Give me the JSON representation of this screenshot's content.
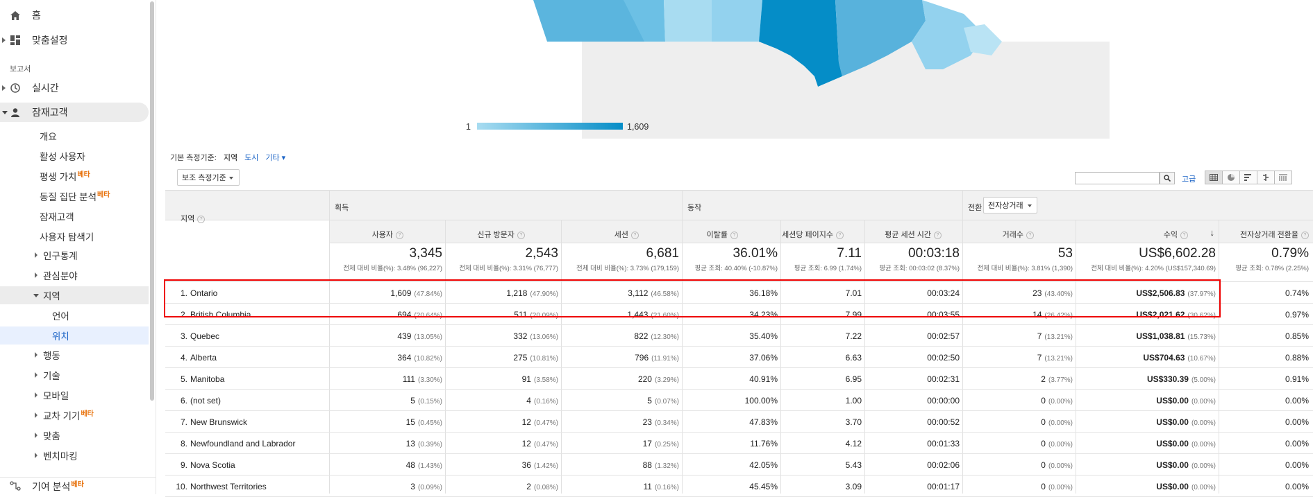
{
  "sidebar": {
    "home": "홈",
    "custom": "맞춤설정",
    "reports_section": "보고서",
    "realtime": "실시간",
    "audience": "잠재고객",
    "items": [
      {
        "label": "개요",
        "beta": ""
      },
      {
        "label": "활성 사용자",
        "beta": ""
      },
      {
        "label": "평생 가치",
        "beta": "베타"
      },
      {
        "label": "동질 집단 분석",
        "beta": "베타"
      },
      {
        "label": "잠재고객",
        "beta": ""
      },
      {
        "label": "사용자 탐색기",
        "beta": ""
      },
      {
        "label": "인구통계",
        "beta": ""
      },
      {
        "label": "관심분야",
        "beta": ""
      },
      {
        "label": "지역",
        "beta": ""
      },
      {
        "label": "언어",
        "beta": ""
      },
      {
        "label": "위치",
        "beta": ""
      },
      {
        "label": "행동",
        "beta": ""
      },
      {
        "label": "기술",
        "beta": ""
      },
      {
        "label": "모바일",
        "beta": ""
      },
      {
        "label": "교차 기기",
        "beta": "베타"
      },
      {
        "label": "맞춤",
        "beta": ""
      },
      {
        "label": "벤치마킹",
        "beta": ""
      }
    ],
    "attribution": "기여 분석",
    "attribution_beta": "베타"
  },
  "map": {
    "legend_min": "1",
    "legend_max": "1,609"
  },
  "toolbar": {
    "primary_dim_label": "기본 측정기준:",
    "dim_region": "지역",
    "dim_city": "도시",
    "dim_other": "기타",
    "secondary_dim": "보조 측정기준",
    "advanced": "고급"
  },
  "table": {
    "dim_header": "지역",
    "groups": {
      "acquisition": "획득",
      "behavior": "동작",
      "conversions": "전환",
      "conversion_select": "전자상거래"
    },
    "columns": [
      "사용자",
      "신규 방문자",
      "세션",
      "이탈률",
      "세션당 페이지수",
      "평균 세션 시간",
      "거래수",
      "수익",
      "전자상거래 전환율"
    ],
    "totals": [
      {
        "big": "3,345",
        "small": "전체 대비 비율(%): 3.48% (96,227)"
      },
      {
        "big": "2,543",
        "small": "전체 대비 비율(%): 3.31% (76,777)"
      },
      {
        "big": "6,681",
        "small": "전체 대비 비율(%): 3.73% (179,159)"
      },
      {
        "big": "36.01%",
        "small": "평균 조회: 40.40% (-10.87%)"
      },
      {
        "big": "7.11",
        "small": "평균 조회: 6.99 (1.74%)"
      },
      {
        "big": "00:03:18",
        "small": "평균 조회: 00:03:02 (8.37%)"
      },
      {
        "big": "53",
        "small": "전체 대비 비율(%): 3.81% (1,390)"
      },
      {
        "big": "US$6,602.28",
        "small": "전체 대비 비율(%): 4.20% (US$157,340.69)"
      },
      {
        "big": "0.79%",
        "small": "평균 조회: 0.78% (2.25%)"
      }
    ],
    "rows": [
      {
        "idx": "1.",
        "name": "Ontario",
        "users": "1,609",
        "users_p": "(47.84%)",
        "new": "1,218",
        "new_p": "(47.90%)",
        "sess": "3,112",
        "sess_p": "(46.58%)",
        "bounce": "36.18%",
        "pps": "7.01",
        "dur": "00:03:24",
        "tx": "23",
        "tx_p": "(43.40%)",
        "rev": "US$2,506.83",
        "rev_p": "(37.97%)",
        "conv": "0.74%"
      },
      {
        "idx": "2.",
        "name": "British Columbia",
        "users": "694",
        "users_p": "(20.64%)",
        "new": "511",
        "new_p": "(20.09%)",
        "sess": "1,443",
        "sess_p": "(21.60%)",
        "bounce": "34.23%",
        "pps": "7.99",
        "dur": "00:03:55",
        "tx": "14",
        "tx_p": "(26.42%)",
        "rev": "US$2,021.62",
        "rev_p": "(30.62%)",
        "conv": "0.97%"
      },
      {
        "idx": "3.",
        "name": "Quebec",
        "users": "439",
        "users_p": "(13.05%)",
        "new": "332",
        "new_p": "(13.06%)",
        "sess": "822",
        "sess_p": "(12.30%)",
        "bounce": "35.40%",
        "pps": "7.22",
        "dur": "00:02:57",
        "tx": "7",
        "tx_p": "(13.21%)",
        "rev": "US$1,038.81",
        "rev_p": "(15.73%)",
        "conv": "0.85%"
      },
      {
        "idx": "4.",
        "name": "Alberta",
        "users": "364",
        "users_p": "(10.82%)",
        "new": "275",
        "new_p": "(10.81%)",
        "sess": "796",
        "sess_p": "(11.91%)",
        "bounce": "37.06%",
        "pps": "6.63",
        "dur": "00:02:50",
        "tx": "7",
        "tx_p": "(13.21%)",
        "rev": "US$704.63",
        "rev_p": "(10.67%)",
        "conv": "0.88%"
      },
      {
        "idx": "5.",
        "name": "Manitoba",
        "users": "111",
        "users_p": "(3.30%)",
        "new": "91",
        "new_p": "(3.58%)",
        "sess": "220",
        "sess_p": "(3.29%)",
        "bounce": "40.91%",
        "pps": "6.95",
        "dur": "00:02:31",
        "tx": "2",
        "tx_p": "(3.77%)",
        "rev": "US$330.39",
        "rev_p": "(5.00%)",
        "conv": "0.91%"
      },
      {
        "idx": "6.",
        "name": "(not set)",
        "users": "5",
        "users_p": "(0.15%)",
        "new": "4",
        "new_p": "(0.16%)",
        "sess": "5",
        "sess_p": "(0.07%)",
        "bounce": "100.00%",
        "pps": "1.00",
        "dur": "00:00:00",
        "tx": "0",
        "tx_p": "(0.00%)",
        "rev": "US$0.00",
        "rev_p": "(0.00%)",
        "conv": "0.00%"
      },
      {
        "idx": "7.",
        "name": "New Brunswick",
        "users": "15",
        "users_p": "(0.45%)",
        "new": "12",
        "new_p": "(0.47%)",
        "sess": "23",
        "sess_p": "(0.34%)",
        "bounce": "47.83%",
        "pps": "3.70",
        "dur": "00:00:52",
        "tx": "0",
        "tx_p": "(0.00%)",
        "rev": "US$0.00",
        "rev_p": "(0.00%)",
        "conv": "0.00%"
      },
      {
        "idx": "8.",
        "name": "Newfoundland and Labrador",
        "users": "13",
        "users_p": "(0.39%)",
        "new": "12",
        "new_p": "(0.47%)",
        "sess": "17",
        "sess_p": "(0.25%)",
        "bounce": "11.76%",
        "pps": "4.12",
        "dur": "00:01:33",
        "tx": "0",
        "tx_p": "(0.00%)",
        "rev": "US$0.00",
        "rev_p": "(0.00%)",
        "conv": "0.00%"
      },
      {
        "idx": "9.",
        "name": "Nova Scotia",
        "users": "48",
        "users_p": "(1.43%)",
        "new": "36",
        "new_p": "(1.42%)",
        "sess": "88",
        "sess_p": "(1.32%)",
        "bounce": "42.05%",
        "pps": "5.43",
        "dur": "00:02:06",
        "tx": "0",
        "tx_p": "(0.00%)",
        "rev": "US$0.00",
        "rev_p": "(0.00%)",
        "conv": "0.00%"
      },
      {
        "idx": "10.",
        "name": "Northwest Territories",
        "users": "3",
        "users_p": "(0.09%)",
        "new": "2",
        "new_p": "(0.08%)",
        "sess": "11",
        "sess_p": "(0.16%)",
        "bounce": "45.45%",
        "pps": "3.09",
        "dur": "00:01:17",
        "tx": "0",
        "tx_p": "(0.00%)",
        "rev": "US$0.00",
        "rev_p": "(0.00%)",
        "conv": "0.00%"
      }
    ]
  },
  "colors": {
    "accent": "#1a63c6",
    "map_dark": "#058dc7",
    "map_light": "#a8dcf1",
    "highlight": "#e00000",
    "beta": "#e8710a"
  }
}
